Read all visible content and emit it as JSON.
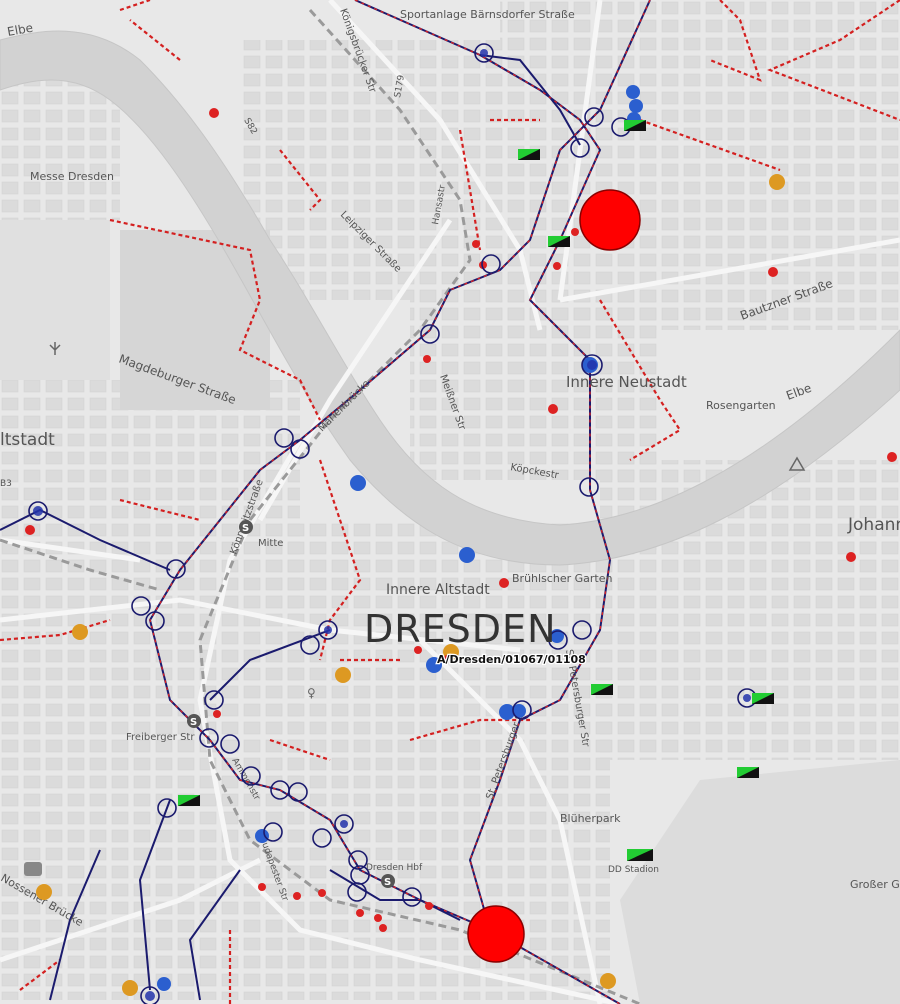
{
  "map": {
    "city_label": "DRESDEN",
    "annotation_label": "A/Dresden/01067/01108",
    "colors": {
      "land": "#e6e6e6",
      "river": "#d4d4d4",
      "route_dark": "#1a1a66",
      "route_dashed": "#dd2222",
      "marker_red": "#dd2222",
      "marker_blue": "#2255cc",
      "marker_orange": "#dd9922",
      "marker_big_red": "#ff0000"
    },
    "labels": {
      "elbe_nw": "Elbe",
      "sportanlage": "Sportanlage Bärnsdorfer Straße",
      "konigsbrucker": "Königsbrücker Str",
      "messe": "Messe Dresden",
      "s82": "S82",
      "s179": "S179",
      "hansastr": "Hansastr",
      "leipziger": "Leipziger Straße",
      "magdeburger": "Magdeburger Straße",
      "bautzner": "Bautzner Straße",
      "innere_neustadt": "Innere Neustadt",
      "rosengarten": "Rosengarten",
      "elbe_e": "Elbe",
      "marienbrucke": "Marienbrücke",
      "meissner": "Meißner Str",
      "kopckestr": "Köpckestr",
      "altstadt_w": "ltstadt",
      "johann": "Johann",
      "konneritz": "Könneritzstraße",
      "mitte": "Mitte",
      "innere_altstadt": "Innere Altstadt",
      "bruhlscher": "Brühlscher Garten",
      "st_petersburger_1": "St. Petersburger Str",
      "st_petersburger_2": "St. Petersburger Str",
      "freiberger": "Freiberger Str",
      "blueherpark": "Blüherpark",
      "dresden_hbf": "Dresden Hbf",
      "dd_stadion": "DD Stadion",
      "grosser_garten": "Großer Ga",
      "nossener": "Nossener Brücke",
      "budapester": "Budapester Str",
      "ammonstr": "Ammonstr",
      "b3": "B3"
    },
    "icons": {
      "suburban_rail": "s-bahn-icon",
      "peak": "peak-icon",
      "gender": "venus-icon",
      "hw": "exit-badge-icon"
    }
  }
}
